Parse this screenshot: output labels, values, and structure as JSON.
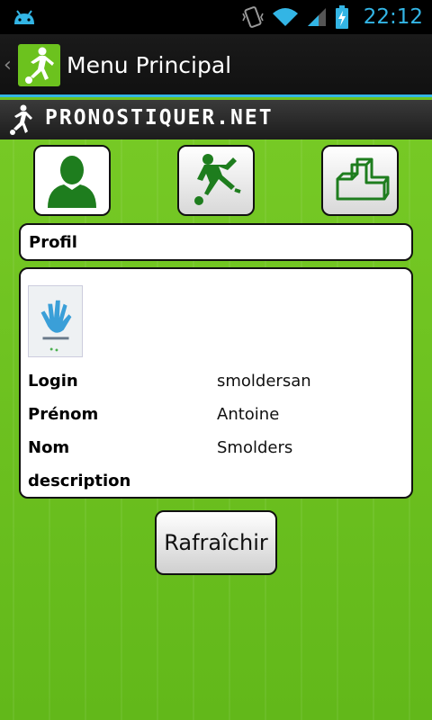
{
  "status_bar": {
    "time": "22:12",
    "icons": [
      "android-debug-icon",
      "vibrate-icon",
      "wifi-icon",
      "signal-icon",
      "battery-charging-icon"
    ]
  },
  "action_bar": {
    "title": "Menu Principal"
  },
  "banner": {
    "brand": "PRONOSTIQUER.NET"
  },
  "nav": {
    "items": [
      "profile",
      "matches",
      "ranking"
    ]
  },
  "profile": {
    "header": "Profil",
    "fields": [
      {
        "label": "Login",
        "value": "smoldersan"
      },
      {
        "label": "Prénom",
        "value": "Antoine"
      },
      {
        "label": "Nom",
        "value": "Smolders"
      },
      {
        "label": "description",
        "value": ""
      }
    ]
  },
  "refresh_label": "Rafraîchir",
  "colors": {
    "background": "#6cc21e",
    "accent": "#33b5e5",
    "icon_green": "#1e7d1e"
  }
}
